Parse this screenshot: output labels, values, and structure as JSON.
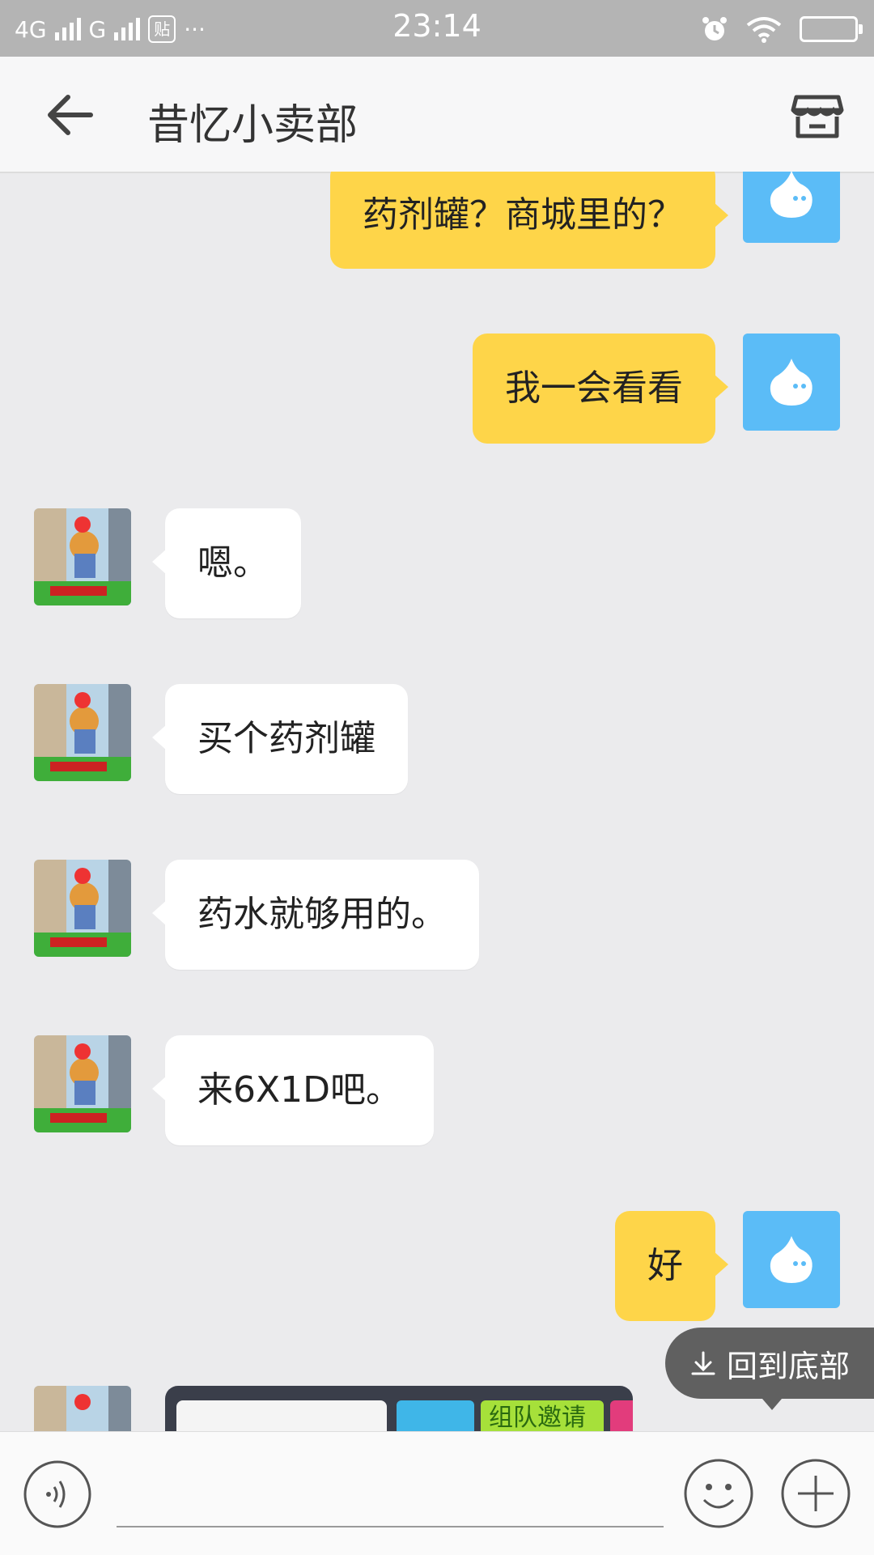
{
  "status_bar": {
    "net1": "4G",
    "net2": "G",
    "notif": "贴",
    "more": "···",
    "time": "23:14"
  },
  "header": {
    "title": "昔忆小卖部"
  },
  "messages": [
    {
      "side": "me",
      "text": "药剂罐？商城里的？"
    },
    {
      "side": "me",
      "text": "我一会看看"
    },
    {
      "side": "them",
      "text": "嗯。"
    },
    {
      "side": "them",
      "text": "买个药剂罐"
    },
    {
      "side": "them",
      "text": "药水就够用的。"
    },
    {
      "side": "them",
      "text": "来6X1D吧。"
    },
    {
      "side": "me",
      "text": "好"
    }
  ],
  "image_message": {
    "caption": "组队邀请"
  },
  "back_to_bottom": {
    "label": "回到底部"
  },
  "input_bar": {
    "placeholder": ""
  },
  "colors": {
    "my_bubble": "#fed549",
    "their_bubble": "#ffffff",
    "my_avatar": "#5bbcf7",
    "background": "#ebebed"
  }
}
